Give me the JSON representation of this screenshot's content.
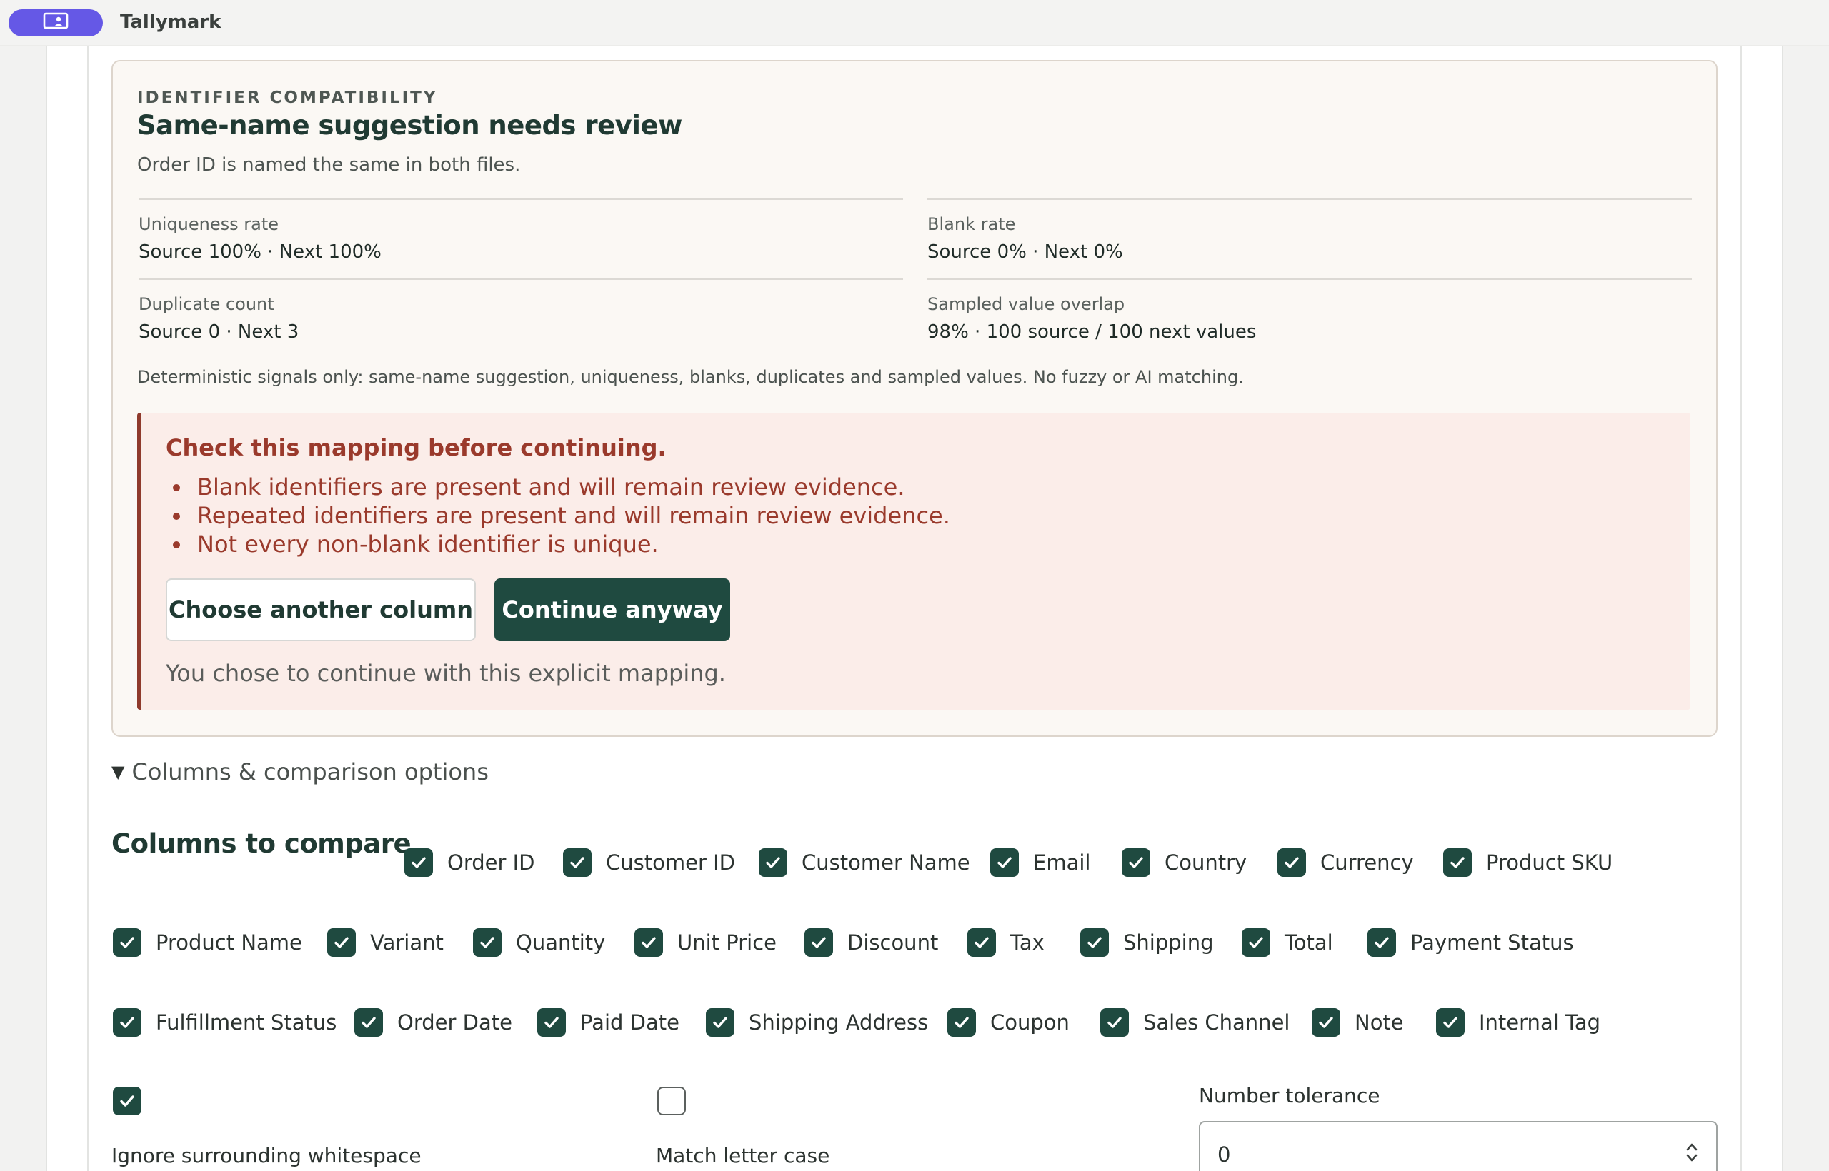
{
  "app": {
    "title": "Tallymark"
  },
  "identifier_card": {
    "eyebrow": "IDENTIFIER COMPATIBILITY",
    "title": "Same-name suggestion needs review",
    "subtitle": "Order ID is named the same in both files.",
    "metrics": [
      {
        "label": "Uniqueness rate",
        "value": "Source 100% · Next 100%"
      },
      {
        "label": "Blank rate",
        "value": "Source 0% · Next 0%"
      },
      {
        "label": "Duplicate count",
        "value": "Source 0 · Next 3"
      },
      {
        "label": "Sampled value overlap",
        "value": "98% · 100 source / 100 next values"
      }
    ],
    "signals_note": "Deterministic signals only: same-name suggestion, uniqueness, blanks, duplicates and sampled values. No fuzzy or AI matching."
  },
  "warning": {
    "title": "Check this mapping before continuing.",
    "items": [
      "Blank identifiers are present and will remain review evidence.",
      "Repeated identifiers are present and will remain review evidence.",
      "Not every non-blank identifier is unique."
    ],
    "choose_label": "Choose another column",
    "continue_label": "Continue anyway",
    "note": "You chose to continue with this explicit mapping.",
    "accent_color": "#9a3a2c"
  },
  "options": {
    "disclosure_label": "Columns & comparison options",
    "columns_title": "Columns to compare",
    "columns": [
      {
        "label": "Order ID",
        "checked": true
      },
      {
        "label": "Customer ID",
        "checked": true
      },
      {
        "label": "Customer Name",
        "checked": true
      },
      {
        "label": "Email",
        "checked": true
      },
      {
        "label": "Country",
        "checked": true
      },
      {
        "label": "Currency",
        "checked": true
      },
      {
        "label": "Product SKU",
        "checked": true
      },
      {
        "label": "Product Name",
        "checked": true
      },
      {
        "label": "Variant",
        "checked": true
      },
      {
        "label": "Quantity",
        "checked": true
      },
      {
        "label": "Unit Price",
        "checked": true
      },
      {
        "label": "Discount",
        "checked": true
      },
      {
        "label": "Tax",
        "checked": true
      },
      {
        "label": "Shipping",
        "checked": true
      },
      {
        "label": "Total",
        "checked": true
      },
      {
        "label": "Payment Status",
        "checked": true
      },
      {
        "label": "Fulfillment Status",
        "checked": true
      },
      {
        "label": "Order Date",
        "checked": true
      },
      {
        "label": "Paid Date",
        "checked": true
      },
      {
        "label": "Shipping Address",
        "checked": true
      },
      {
        "label": "Coupon",
        "checked": true
      },
      {
        "label": "Sales Channel",
        "checked": true
      },
      {
        "label": "Note",
        "checked": true
      },
      {
        "label": "Internal Tag",
        "checked": true
      }
    ],
    "ignore_whitespace": {
      "label": "Ignore surrounding whitespace",
      "checked": true
    },
    "match_case": {
      "label": "Match letter case",
      "checked": false
    },
    "number_tolerance": {
      "label": "Number tolerance",
      "value": "0"
    }
  },
  "colors": {
    "primary": "#1f4a40",
    "app_pill": "#6558e6",
    "card_bg": "#fbf8f4",
    "warning_bg": "#fbede9"
  }
}
